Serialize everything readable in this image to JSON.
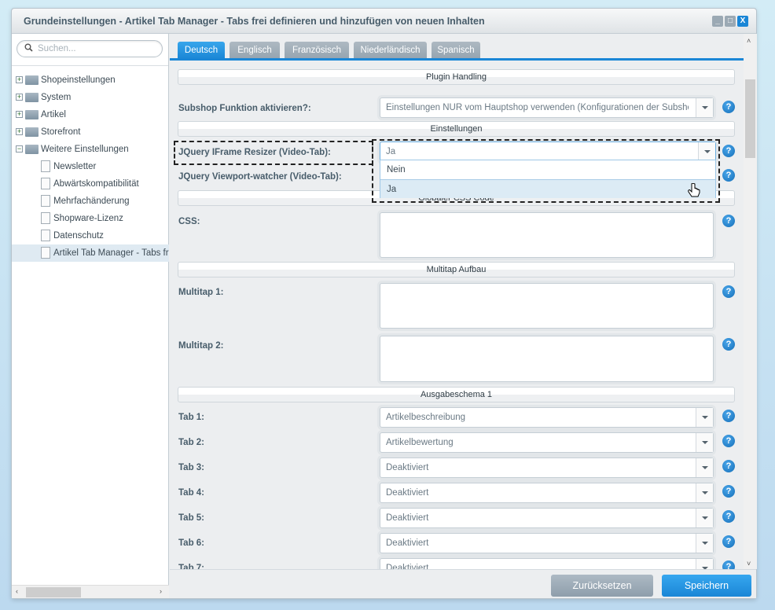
{
  "window": {
    "title": "Grundeinstellungen - Artikel Tab Manager - Tabs frei definieren und hinzufügen von neuen Inhalten",
    "minimize": "_",
    "maximize": "□",
    "close": "X"
  },
  "sidebar": {
    "search_placeholder": "Suchen...",
    "items": [
      {
        "label": "Shopeinstellungen",
        "type": "folder",
        "expanded": false
      },
      {
        "label": "System",
        "type": "folder",
        "expanded": false
      },
      {
        "label": "Artikel",
        "type": "folder",
        "expanded": false
      },
      {
        "label": "Storefront",
        "type": "folder",
        "expanded": false
      },
      {
        "label": "Weitere Einstellungen",
        "type": "folder",
        "expanded": true
      },
      {
        "label": "Newsletter",
        "type": "leaf"
      },
      {
        "label": "Abwärtskompatibilität",
        "type": "leaf"
      },
      {
        "label": "Mehrfachänderung",
        "type": "leaf"
      },
      {
        "label": "Shopware-Lizenz",
        "type": "leaf"
      },
      {
        "label": "Datenschutz",
        "type": "leaf"
      },
      {
        "label": "Artikel Tab Manager - Tabs frei definieren",
        "type": "leaf",
        "selected": true
      }
    ]
  },
  "tabs": [
    {
      "label": "Deutsch",
      "active": true
    },
    {
      "label": "Englisch"
    },
    {
      "label": "Französisch"
    },
    {
      "label": "Niederländisch"
    },
    {
      "label": "Spanisch"
    }
  ],
  "form": {
    "sections": {
      "plugin": "Plugin Handling",
      "settings": "Einstellungen",
      "css": "Globaler CSS Code",
      "multitap": "Multitap Aufbau",
      "schema": "Ausgabeschema 1"
    },
    "subshop": {
      "label": "Subshop Funktion aktivieren?:",
      "value": "Einstellungen NUR vom Hauptshop verwenden (Konfigurationen der Subshops werden ignoriert)"
    },
    "iframe": {
      "label": "JQuery IFrame Resizer (Video-Tab):",
      "value": "Ja",
      "options": [
        "Nein",
        "Ja"
      ],
      "highlighted": "Ja"
    },
    "viewport": {
      "label": "JQuery Viewport-watcher (Video-Tab):"
    },
    "css": {
      "label": "CSS:",
      "value": ""
    },
    "multitap1": {
      "label": "Multitap 1:",
      "value": ""
    },
    "multitap2": {
      "label": "Multitap 2:",
      "value": ""
    },
    "tab_rows": [
      {
        "label": "Tab 1:",
        "value": "Artikelbeschreibung"
      },
      {
        "label": "Tab 2:",
        "value": "Artikelbewertung"
      },
      {
        "label": "Tab 3:",
        "value": "Deaktiviert"
      },
      {
        "label": "Tab 4:",
        "value": "Deaktiviert"
      },
      {
        "label": "Tab 5:",
        "value": "Deaktiviert"
      },
      {
        "label": "Tab 6:",
        "value": "Deaktiviert"
      },
      {
        "label": "Tab 7:",
        "value": "Deaktiviert"
      }
    ],
    "help": "?"
  },
  "footer": {
    "reset": "Zurücksetzen",
    "save": "Speichern"
  },
  "colors": {
    "accent": "#1a86d6",
    "reset_button": "#9aa9b5"
  }
}
